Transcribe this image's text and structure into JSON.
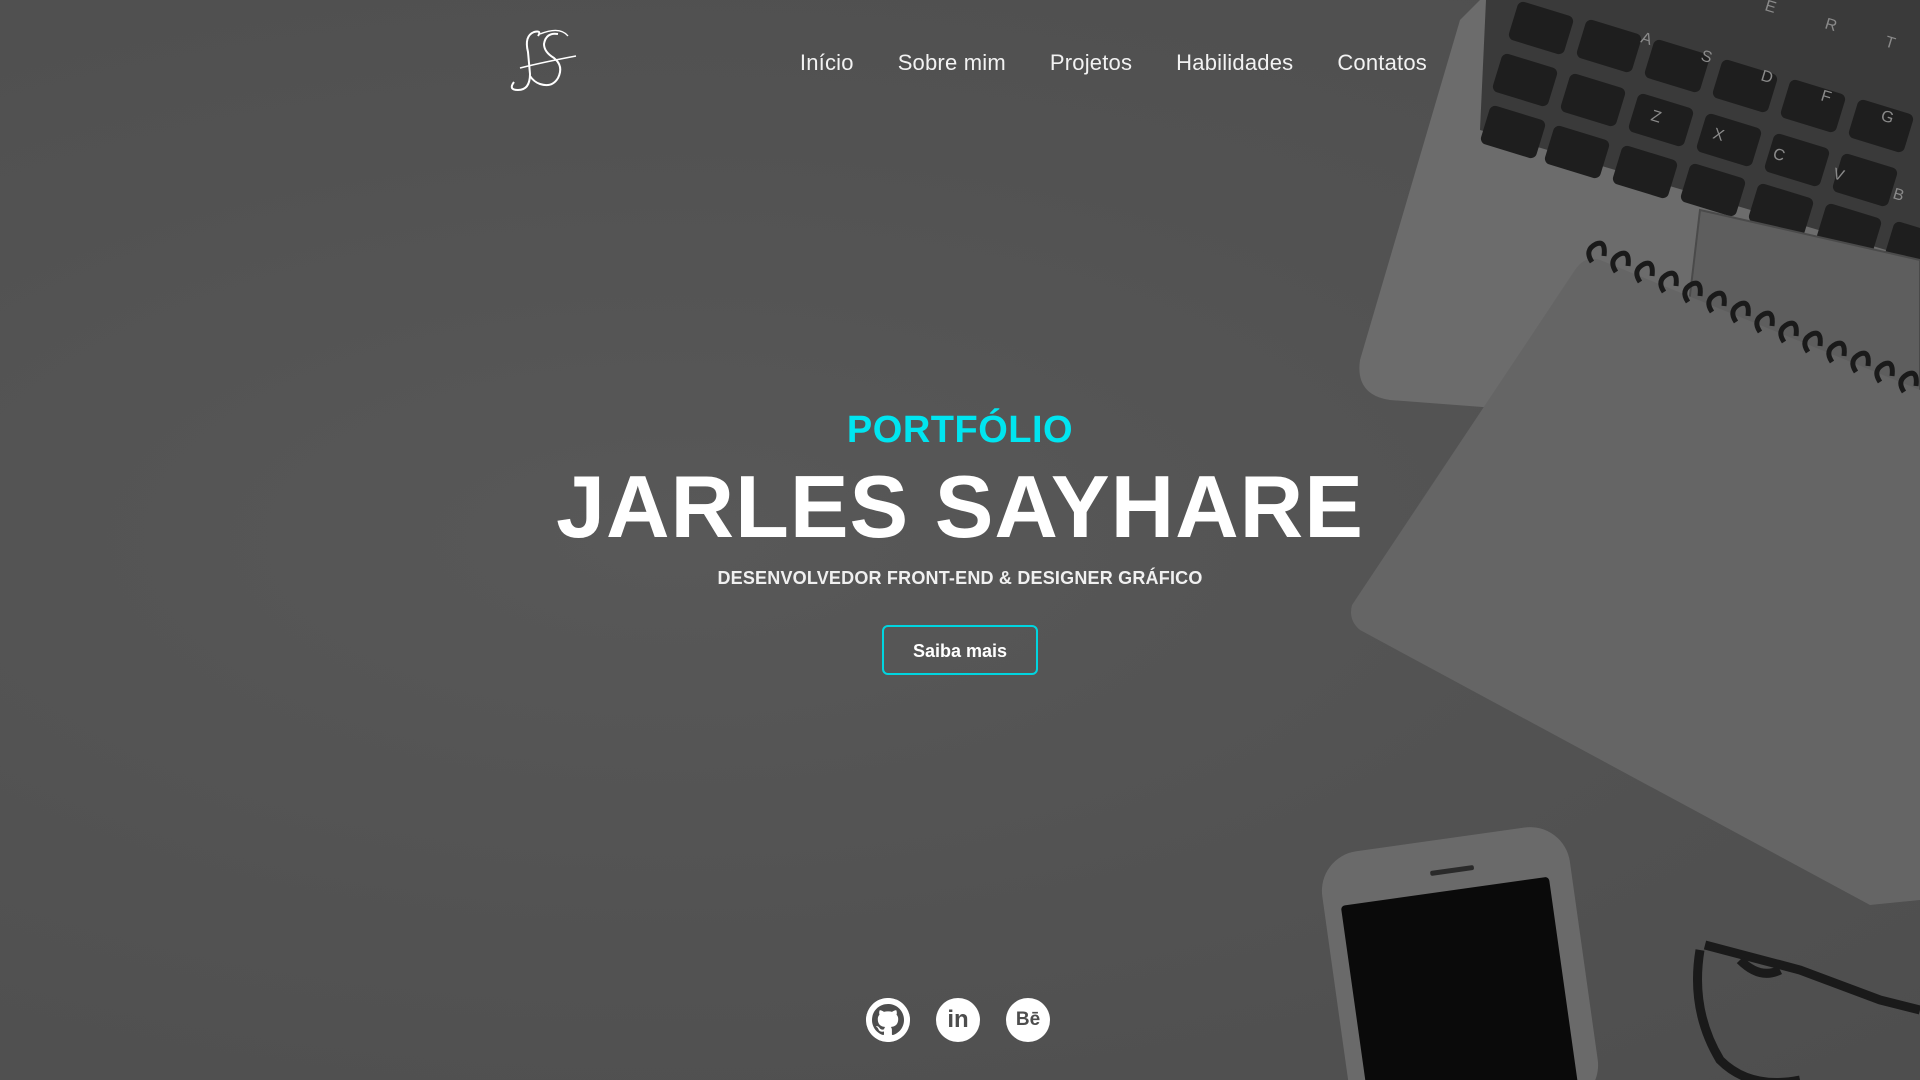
{
  "header": {
    "logo_text": "JS",
    "nav": [
      {
        "label": "Início"
      },
      {
        "label": "Sobre mim"
      },
      {
        "label": "Projetos"
      },
      {
        "label": "Habilidades"
      },
      {
        "label": "Contatos"
      }
    ]
  },
  "hero": {
    "eyebrow": "PORTFÓLIO",
    "title": "JARLES SAYHARE",
    "subtitle": "DESENVOLVEDOR FRONT-END & DESIGNER GRÁFICO",
    "cta_label": "Saiba mais"
  },
  "social": [
    {
      "name": "github-icon"
    },
    {
      "name": "linkedin-icon",
      "glyph": "in"
    },
    {
      "name": "behance-icon",
      "glyph": "Bē"
    }
  ],
  "colors": {
    "accent": "#00e5f0",
    "background": "#545454",
    "text": "#ffffff"
  },
  "keyboard_keys": [
    "A",
    "S",
    "D",
    "F",
    "G",
    "Z",
    "X",
    "C",
    "V",
    "B",
    "E",
    "R",
    "T"
  ]
}
